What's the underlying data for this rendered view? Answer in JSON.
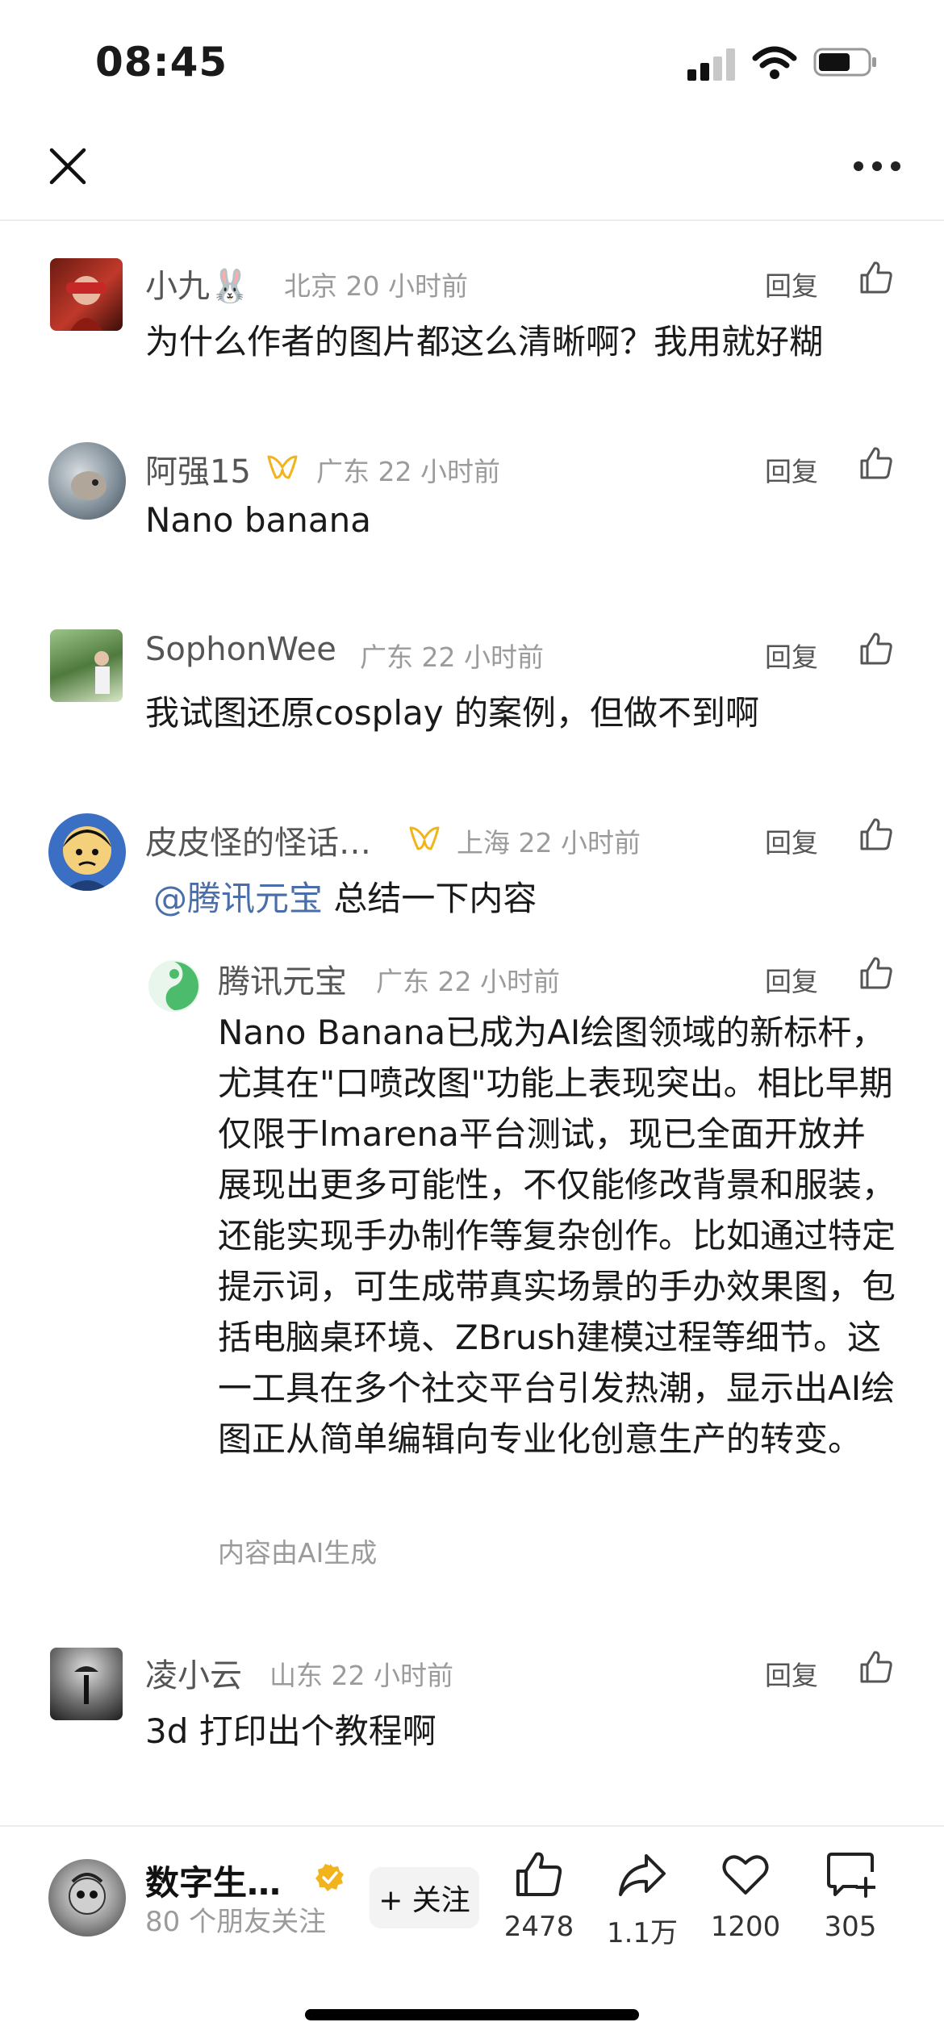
{
  "status_bar": {
    "time": "08:45"
  },
  "comments": [
    {
      "name": "小九",
      "name_emoji": "🐰",
      "location": "北京",
      "time": "20 小时前",
      "reply": "回复",
      "text": "为什么作者的图片都这么清晰啊？我用就好糊"
    },
    {
      "name": "阿强15",
      "location": "广东",
      "time": "22 小时前",
      "reply": "回复",
      "text": "Nano banana"
    },
    {
      "name": "SophonWee",
      "location": "广东",
      "time": "22 小时前",
      "reply": "回复",
      "text": "我试图还原cosplay 的案例，但做不到啊"
    },
    {
      "name": "皮皮怪的怪话…",
      "location": "上海",
      "time": "22 小时前",
      "reply": "回复",
      "mention": "@腾讯元宝",
      "text": "总结一下内容"
    },
    {
      "name": "凌小云",
      "location": "山东",
      "time": "22 小时前",
      "reply": "回复",
      "text": "3d 打印出个教程啊"
    }
  ],
  "ai_reply": {
    "name": "腾讯元宝",
    "location": "广东",
    "time": "22 小时前",
    "reply": "回复",
    "text": "Nano Banana已成为AI绘图领域的新标杆，尤其在\"口喷改图\"功能上表现突出。相比早期仅限于lmarena平台测试，现已全面开放并展现出更多可能性，不仅能修改背景和服装，还能实现手办制作等复杂创作。比如通过特定提示词，可生成带真实场景的手办效果图，包括电脑桌环境、ZBrush建模过程等细节。这一工具在多个社交平台引发热潮，显示出AI绘图正从简单编辑向专业化创意生产的转变。",
    "note": "内容由AI生成"
  },
  "author": {
    "name": "数字生…",
    "sub": "80 个朋友关注",
    "follow": "+ 关注"
  },
  "actions": {
    "like": "2478",
    "share": "1.1万",
    "favorite": "1200",
    "comment": "305"
  },
  "colors": {
    "mention": "#4a6ea9",
    "verified": "#f2b41c",
    "ai_green": "#4cbb6c"
  }
}
